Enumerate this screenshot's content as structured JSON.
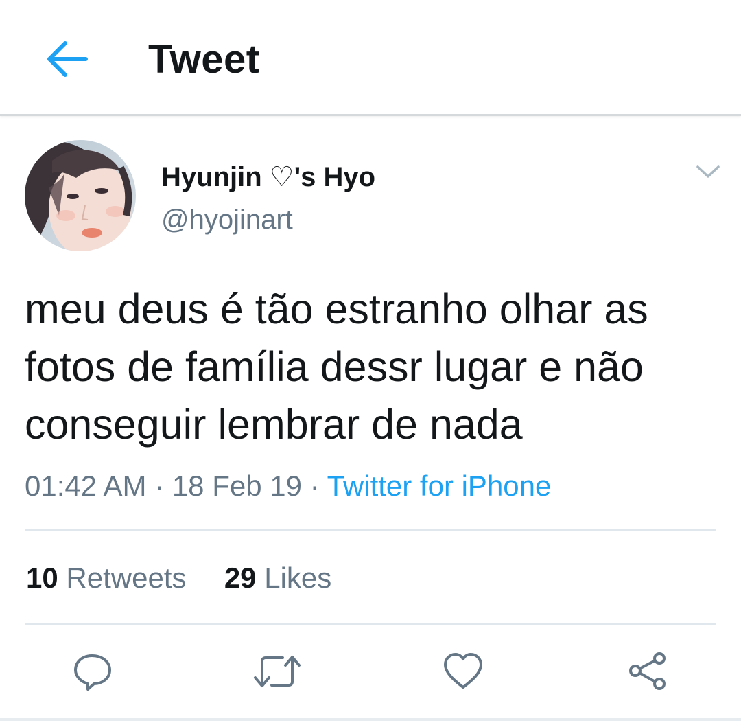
{
  "header": {
    "title": "Tweet",
    "back_icon": "arrow-left-icon",
    "accent_color": "#1da1f2"
  },
  "tweet": {
    "author": {
      "display_name": "Hyunjin ♡'s Hyo",
      "handle": "@hyojinart"
    },
    "text": "meu deus é tão estranho olhar as fotos de família dessr lugar e não conseguir lembrar de nada",
    "time": "01:42 AM",
    "separator": "·",
    "date": "18 Feb 19",
    "source": "Twitter for iPhone",
    "stats": {
      "retweets_count": "10",
      "retweets_label": "Retweets",
      "likes_count": "29",
      "likes_label": "Likes"
    },
    "actions": [
      "reply-icon",
      "retweet-icon",
      "like-icon",
      "share-icon"
    ]
  }
}
